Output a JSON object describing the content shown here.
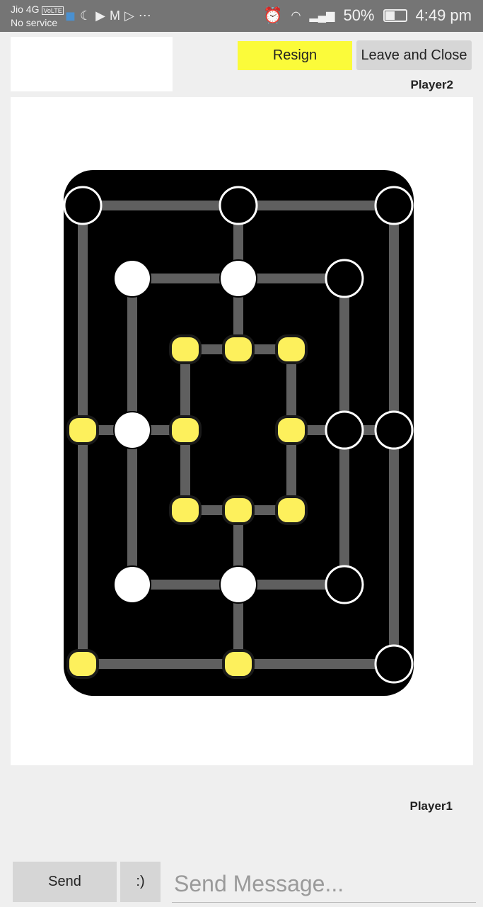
{
  "status_bar": {
    "carrier": "Jio 4G",
    "volte": "VoLTE",
    "service": "No service",
    "icons": [
      "shield-icon",
      "moon-icon",
      "youtube-icon",
      "gmail-icon",
      "play-store-icon",
      "more-icon"
    ],
    "battery": "50%",
    "battery_level": 0.5,
    "time": "4:49 pm"
  },
  "header": {
    "resign_label": "Resign",
    "leave_label": "Leave and Close",
    "opponent": "Player2"
  },
  "colors": {
    "resign": "#fbfb3a",
    "board": "#000000",
    "lines": "#5f5f5f",
    "empty_point": "#fdf05c",
    "white_piece": "#ffffff",
    "black_piece": "#000000"
  },
  "board": {
    "rings": {
      "outer": [
        "black",
        "black",
        "black",
        "black",
        "black",
        "empty",
        "empty",
        "empty"
      ],
      "middle": [
        "white",
        "white",
        "black",
        "black",
        "black",
        "white",
        "white",
        "white"
      ],
      "inner": [
        "empty",
        "empty",
        "empty",
        "empty",
        "empty",
        "empty",
        "empty",
        "empty"
      ]
    },
    "order": "top-left, top-middle, top-right, middle-right, bottom-right, bottom-middle, bottom-left, middle-left"
  },
  "footer": {
    "player": "Player1",
    "send_label": "Send",
    "emoji_label": ":)",
    "message_placeholder": "Send Message...",
    "message_value": ""
  }
}
